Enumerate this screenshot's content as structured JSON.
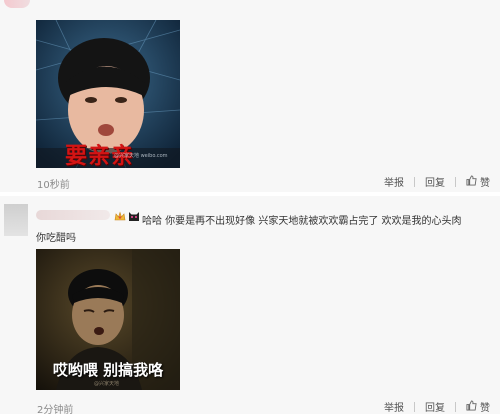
{
  "comments": [
    {
      "meme_caption": "要亲亲",
      "watermark": "@兴家天地 weibo.com",
      "time": "10秒前",
      "actions": {
        "report": "举报",
        "reply": "回复",
        "like": "赞"
      }
    },
    {
      "text_line1": "哈哈 你要是再不出现好像 兴家天地就被欢欢霸占完了 欢欢是我的心头肉",
      "text_line2": "你吃醋吗",
      "meme_caption": "哎哟喂 别搞我咯",
      "watermark": "@兴家天地",
      "time": "2分钟前",
      "actions": {
        "report": "举报",
        "reply": "回复",
        "like": "赞"
      }
    }
  ]
}
